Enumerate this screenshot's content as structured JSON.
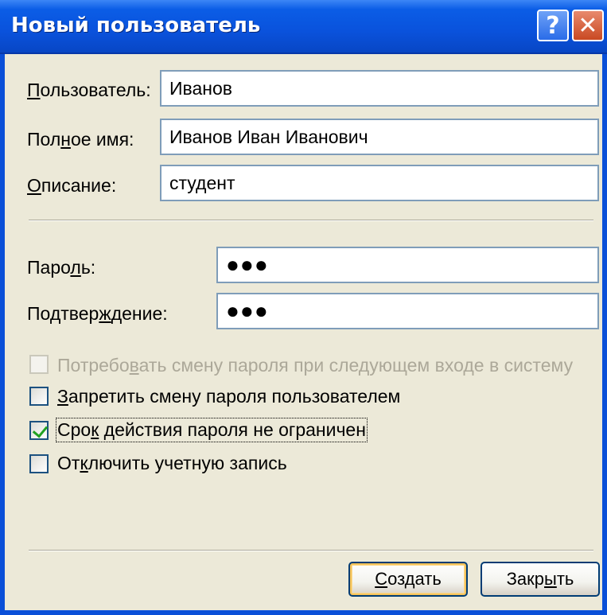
{
  "window": {
    "title": "Новый пользователь",
    "help_glyph": "?",
    "close_glyph": "✕"
  },
  "fields": {
    "username": {
      "label_pre": "",
      "label_key": "П",
      "label_post": "ользователь:",
      "value": "Иванов"
    },
    "fullname": {
      "label_pre": "Пол",
      "label_key": "н",
      "label_post": "ое имя:",
      "value": "Иванов Иван Иванович"
    },
    "description": {
      "label_pre": "",
      "label_key": "О",
      "label_post": "писание:",
      "value": "студент"
    },
    "password": {
      "label_pre": "Паро",
      "label_key": "л",
      "label_post": "ь:",
      "value": "●●●"
    },
    "confirm": {
      "label_pre": "Подтвер",
      "label_key": "ж",
      "label_post": "дение:",
      "value": "●●●"
    }
  },
  "options": [
    {
      "label_pre": "Потребо",
      "label_key": "в",
      "label_post": "ать смену пароля при следующем входе в систему",
      "checked": false,
      "enabled": false
    },
    {
      "label_pre": "",
      "label_key": "З",
      "label_post": "апретить смену пароля пользователем",
      "checked": false,
      "enabled": true
    },
    {
      "label_pre": "Сро",
      "label_key": "к",
      "label_post": " действия пароля не ограничен",
      "checked": true,
      "enabled": true
    },
    {
      "label_pre": "От",
      "label_key": "к",
      "label_post": "лючить учетную запись",
      "checked": false,
      "enabled": true
    }
  ],
  "buttons": {
    "create": {
      "label_pre": "",
      "label_key": "С",
      "label_post": "оздать"
    },
    "close": {
      "label_pre": "Закр",
      "label_key": "ы",
      "label_post": "ть"
    }
  },
  "colors": {
    "titlebar": "#0a52dc",
    "dialog_bg": "#ece9d8",
    "field_border": "#7f9db9",
    "checkbox_border": "#1c5180",
    "check_mark": "#21a121",
    "disabled_text": "#aca899",
    "default_button_glow": "#f5c35a"
  }
}
